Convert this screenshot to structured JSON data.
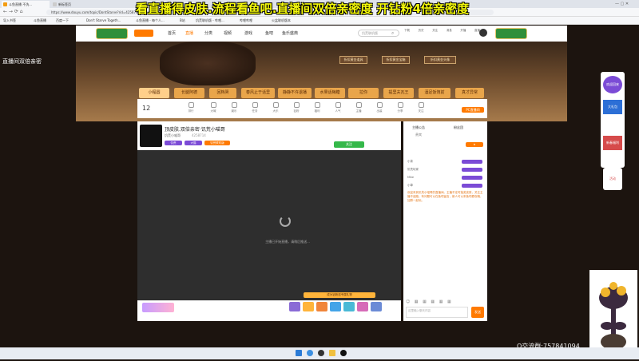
{
  "overlay": {
    "title": "看直播得皮肤.流程看鱼吧.直播间双倍亲密度 开钻粉4倍亲密度",
    "left_caption_1": "直播间双倍亲密",
    "left_caption_2": "",
    "qq": "Q交流群:757841094"
  },
  "browser": {
    "tabs": [
      "斗鱼直播 不洗...",
      "新标签页"
    ],
    "url": "https://www.douyu.com/topic/DontStarve?rid=4258714",
    "bookmarks": [
      "导入书签",
      "斗鱼直播",
      "百度一下",
      "Don't Starve Togeth...",
      "斗鱼直播 - 每个人...",
      "B站",
      "饥荒联机版 - 哔哩...",
      "哔哩哔哩",
      "火盆联机版本"
    ]
  },
  "site": {
    "nav": [
      "首页",
      "直播",
      "分类",
      "视频",
      "游戏",
      "鱼吧",
      "鱼乐盛典"
    ],
    "search_placeholder": "饥荒联机版",
    "header_icons": [
      "下载",
      "历史",
      "关注",
      "消息",
      "开播",
      "直播"
    ],
    "banner_buttons": [
      "折扣黄金道具",
      "折扣黄金宝箱",
      "折扣黄金头像"
    ],
    "room_tabs": [
      "小程圆",
      "长腿阿德",
      "回档哭",
      "春风止于话里",
      "静静不许退播",
      "水果话梅糖",
      "拉你",
      "提里夫瓦王",
      "酒足饭饱前",
      "真才异常"
    ],
    "categories": [
      "12",
      "排行",
      "大喊",
      "娱乐",
      "任务",
      "大乐",
      "钻粉",
      "福利",
      "人气",
      "主播",
      "出装",
      "分享",
      "关注"
    ],
    "pc_button": "PC直播间"
  },
  "player": {
    "title": "顶皮肤.双倍亲密·饥荒小喵哥",
    "streamer": "饥荒小喵哥",
    "room_id": "4258714",
    "tags": [
      "饥荒",
      "大猫",
      "饥荒联机版"
    ],
    "follow": "关注",
    "loading_text": "主播已开始直播，请稍后推送...",
    "gift_promo": "成为钻粉送专属礼物"
  },
  "chat": {
    "tabs": [
      "主播公告",
      "粉丝团",
      "贵宾"
    ],
    "announcement": "欢迎来到饥荒小喵哥的直播间。主播不定时抽奖皮肤，关注主播不迷路，有问题可以在鱼吧留言，新人可以来鱼吧看攻略，加群一起玩。",
    "users": [
      "小茶",
      "饥荒玩家",
      "Mike",
      "小草"
    ],
    "input_placeholder": "这里输入聊天内容",
    "send": "发送"
  },
  "right_panel": {
    "items": [
      "欢迎回来",
      "大礼包",
      "新春福利",
      "活动"
    ]
  },
  "colors": {
    "accent": "#ff7a00",
    "tab": "#e9a54a",
    "purple": "#7b4bd6",
    "overlay": "#f4f90a"
  }
}
